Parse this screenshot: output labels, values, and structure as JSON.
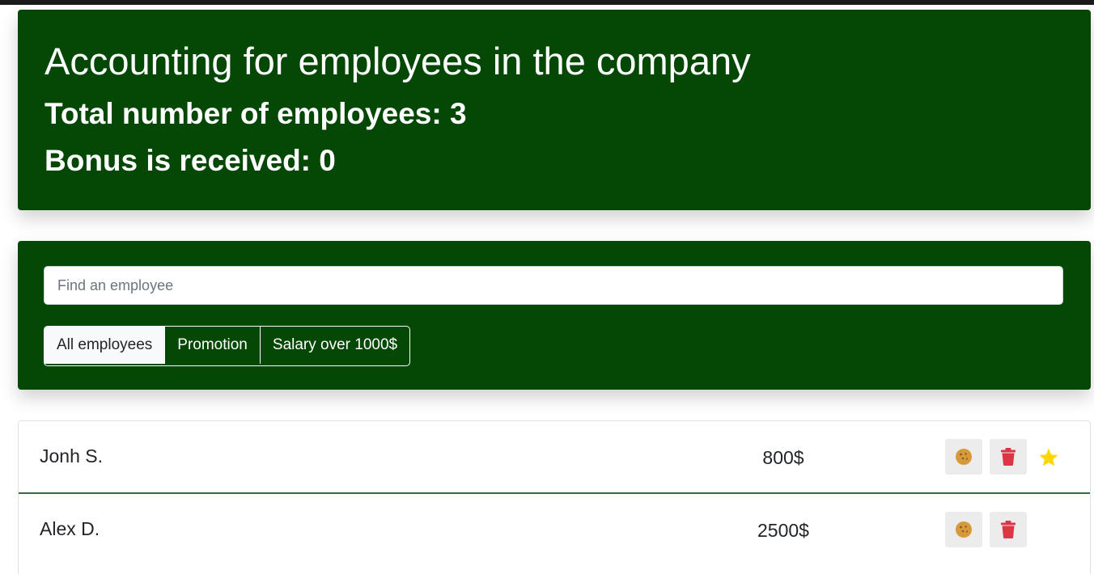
{
  "app": {
    "title": "Accounting for employees in the company",
    "total_label": "Total number of employees: 3",
    "bonus_label": "Bonus is received: 0"
  },
  "search": {
    "placeholder": "Find an employee",
    "value": ""
  },
  "filters": [
    {
      "label": "All employees",
      "active": true
    },
    {
      "label": "Promotion",
      "active": false
    },
    {
      "label": "Salary over 1000$",
      "active": false
    }
  ],
  "employees": [
    {
      "name": "Jonh S.",
      "salary": "800$",
      "starred": true
    },
    {
      "name": "Alex D.",
      "salary": "2500$",
      "starred": false
    }
  ],
  "icons": {
    "increase": "cookie-icon",
    "delete": "trash-icon",
    "favorite": "star-icon"
  },
  "colors": {
    "panel_bg": "#054805",
    "cookie": "#d79a3b",
    "trash": "#dc3545",
    "star": "#ffd700"
  }
}
